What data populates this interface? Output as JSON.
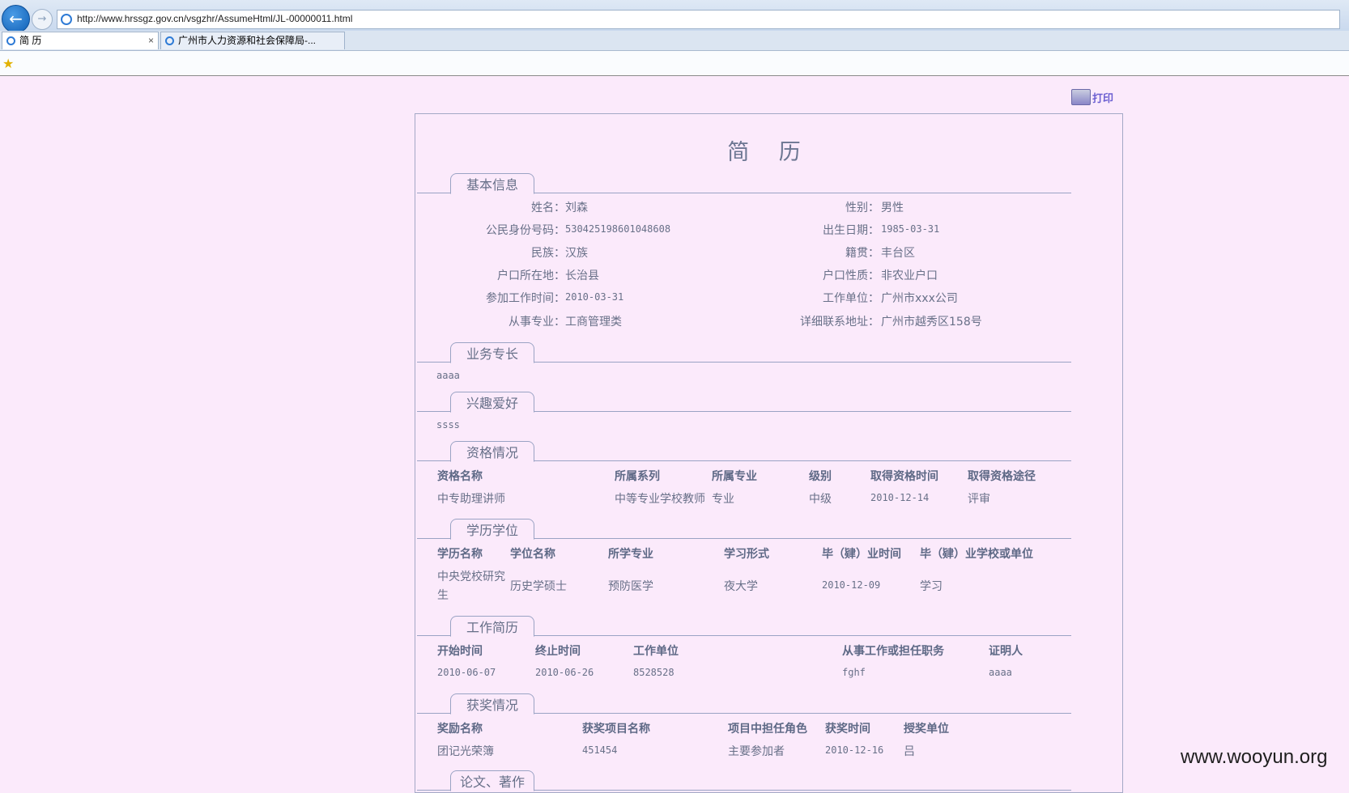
{
  "browser": {
    "url": "http://www.hrssgz.gov.cn/vsgzhr/AssumeHtml/JL-00000011.html",
    "tabs": [
      {
        "label": "简 历",
        "close": "×"
      },
      {
        "label": "广州市人力资源和社会保障局-..."
      }
    ]
  },
  "toolbar": {
    "print_label": "打印"
  },
  "document": {
    "title": "简 历",
    "basic": {
      "heading": "基本信息",
      "fields": [
        {
          "label": "姓名：",
          "value": "刘森"
        },
        {
          "label": "性别：",
          "value": "男性"
        },
        {
          "label": "公民身份号码：",
          "value": "530425198601048608"
        },
        {
          "label": "出生日期：",
          "value": "1985-03-31"
        },
        {
          "label": "民族：",
          "value": "汉族"
        },
        {
          "label": "籍贯：",
          "value": "丰台区"
        },
        {
          "label": "户口所在地：",
          "value": "长治县"
        },
        {
          "label": "户口性质：",
          "value": "非农业户口"
        },
        {
          "label": "参加工作时间：",
          "value": "2010-03-31"
        },
        {
          "label": "工作单位：",
          "value": "广州市xxx公司"
        },
        {
          "label": "从事专业：",
          "value": "工商管理类"
        },
        {
          "label": "详细联系地址：",
          "value": "广州市越秀区158号"
        }
      ]
    },
    "specialty": {
      "heading": "业务专长",
      "text": "aaaa"
    },
    "hobby": {
      "heading": "兴趣爱好",
      "text": "ssss"
    },
    "qualification": {
      "heading": "资格情况",
      "headers": [
        "资格名称",
        "所属系列",
        "所属专业",
        "级别",
        "取得资格时间",
        "取得资格途径"
      ],
      "row": [
        "中专助理讲师",
        "中等专业学校教师",
        "专业",
        "中级",
        "2010-12-14",
        "评审"
      ]
    },
    "education": {
      "heading": "学历学位",
      "headers": [
        "学历名称",
        "学位名称",
        "所学专业",
        "学习形式",
        "毕（肄）业时间",
        "毕（肄）业学校或单位"
      ],
      "row": [
        "中央党校研究",
        "生",
        "历史学硕士",
        "预防医学",
        "夜大学",
        "2010-12-09",
        "学习"
      ]
    },
    "work": {
      "heading": "工作简历",
      "headers": [
        "开始时间",
        "终止时间",
        "工作单位",
        "从事工作或担任职务",
        "证明人"
      ],
      "row": [
        "2010-06-07",
        "2010-06-26",
        "8528528",
        "fghf",
        "aaaa"
      ]
    },
    "awards": {
      "heading": "获奖情况",
      "headers": [
        "奖励名称",
        "获奖项目名称",
        "项目中担任角色",
        "获奖时间",
        "授奖单位"
      ],
      "row": [
        "团记光荣簿",
        "451454",
        "主要参加者",
        "2010-12-16",
        "吕"
      ]
    },
    "papers": {
      "heading": "论文、著作"
    }
  },
  "watermark": "www.wooyun.org"
}
